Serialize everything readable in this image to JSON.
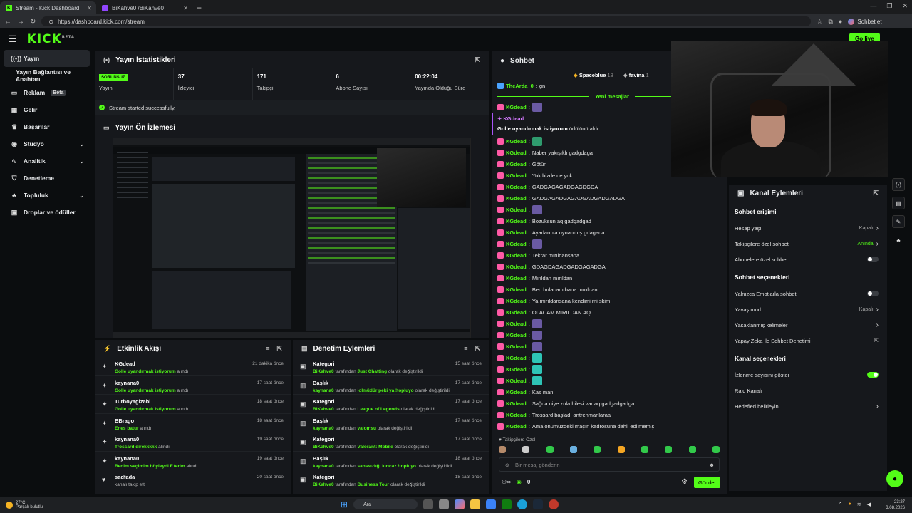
{
  "browser": {
    "tabs": [
      {
        "label": "Stream - Kick Dashboard",
        "active": true
      },
      {
        "label": "BiKahve0 /BiKahve0",
        "active": false
      }
    ],
    "url": "https://dashboard.kick.com/stream",
    "chat_button": "Sohbet et"
  },
  "header": {
    "logo": "KICK",
    "logo_beta": "BETA",
    "go_live": "Go live"
  },
  "sidebar": {
    "items": [
      {
        "label": "Yayın",
        "icon": "broadcast-icon",
        "active": true
      },
      {
        "label": "Yayın Bağlantısı ve Anahtarı",
        "sub": true
      },
      {
        "label": "Reklam",
        "icon": "ad-icon",
        "badge": "Beta"
      },
      {
        "label": "Gelir",
        "icon": "money-icon"
      },
      {
        "label": "Başarılar",
        "icon": "trophy-icon"
      },
      {
        "label": "Stüdyo",
        "icon": "studio-icon",
        "chevron": true
      },
      {
        "label": "Analitik",
        "icon": "chart-icon",
        "chevron": true
      },
      {
        "label": "Denetleme",
        "icon": "shield-icon"
      },
      {
        "label": "Topluluk",
        "icon": "community-icon",
        "chevron": true
      },
      {
        "label": "Droplar ve ödüller",
        "icon": "gift-icon"
      }
    ]
  },
  "stats": {
    "title": "Yayın İstatistikleri",
    "items": [
      {
        "value": "SORUNSUZ",
        "label": "Yayın"
      },
      {
        "value": "37",
        "label": "İzleyici"
      },
      {
        "value": "171",
        "label": "Takipçi"
      },
      {
        "value": "6",
        "label": "Abone Sayısı"
      },
      {
        "value": "00:22:04",
        "label": "Yayında Olduğu Süre"
      }
    ],
    "status": "Stream started successfully."
  },
  "preview": {
    "title": "Yayın Ön İzlemesi"
  },
  "activity": {
    "title": "Etkinlik Akışı",
    "rows": [
      {
        "name": "KGdead",
        "reward": "Golle uyandırmak istiyorum",
        "suffix": "alındı",
        "time": "21 dakika önce"
      },
      {
        "name": "kaynana0",
        "reward": "Golle uyandırmak istiyorum",
        "suffix": "alındı",
        "time": "17 saat önce"
      },
      {
        "name": "Turboyagizabi",
        "reward": "Golle uyandırmak istiyorum",
        "suffix": "alındı",
        "time": "18 saat önce"
      },
      {
        "name": "BBrago",
        "reward": "Enes batur",
        "suffix": "alındı",
        "time": "18 saat önce"
      },
      {
        "name": "kaynana0",
        "reward": "Trossard direkkkkk",
        "suffix": "alındı",
        "time": "19 saat önce"
      },
      {
        "name": "kaynana0",
        "reward": "Benim seçimim böyleydi F.terim",
        "suffix": "alındı",
        "time": "19 saat önce"
      },
      {
        "name": "sadfada",
        "reward": "",
        "suffix": "kanalı takip etti",
        "time": "20 saat önce"
      }
    ]
  },
  "moderation": {
    "title": "Denetim Eylemleri",
    "rows": [
      {
        "type": "Kategori",
        "by": "BiKahve0",
        "mid": "tarafından",
        "value": "Just Chatting",
        "suffix": "olarak değiştirildi",
        "time": "15 saat önce"
      },
      {
        "type": "Başlık",
        "by": "kaynana0",
        "mid": "tarafından",
        "value": "lolmüdür peki ya !topluyo",
        "suffix": "olarak değiştirildi",
        "time": "17 saat önce"
      },
      {
        "type": "Kategori",
        "by": "BiKahve0",
        "mid": "tarafından",
        "value": "League of Legends",
        "suffix": "olarak değiştirildi",
        "time": "17 saat önce"
      },
      {
        "type": "Başlık",
        "by": "kaynana0",
        "mid": "tarafından",
        "value": "valomsu",
        "suffix": "olarak değiştirildi",
        "time": "17 saat önce"
      },
      {
        "type": "Kategori",
        "by": "BiKahve0",
        "mid": "tarafından",
        "value": "Valorant: Mobile",
        "suffix": "olarak değiştirildi",
        "time": "17 saat önce"
      },
      {
        "type": "Başlık",
        "by": "kaynana0",
        "mid": "tarafından",
        "value": "sanssızlığı kırıcaz !topluyo",
        "suffix": "olarak değiştirildi",
        "time": "18 saat önce"
      },
      {
        "type": "Kategori",
        "by": "BiKahve0",
        "mid": "tarafından",
        "value": "Business Tour",
        "suffix": "olarak değiştirildi",
        "time": "18 saat önce"
      }
    ]
  },
  "chat": {
    "title": "Sohbet",
    "leaders": [
      {
        "name": "Spaceblue",
        "count": "13"
      },
      {
        "name": "favina",
        "count": "1"
      }
    ],
    "top_msg": {
      "user": "TheArda_0",
      "text": "gn"
    },
    "new_messages": "Yeni mesajlar",
    "redeem": {
      "user": "KGdead",
      "text": "Golle uyandırmak istiyorum",
      "suffix": "ödülünü aldı"
    },
    "messages": [
      {
        "user": "KGdead",
        "text": "",
        "emote": "p"
      },
      {
        "user": "KGdead",
        "text": "",
        "emote": "g"
      },
      {
        "user": "KGdead",
        "text": "Naber yakışıklı gadgdaga"
      },
      {
        "user": "KGdead",
        "text": "Götün"
      },
      {
        "user": "KGdead",
        "text": "Yok bizde de yok"
      },
      {
        "user": "KGdead",
        "text": "GADGAGAGADGAGDGDA"
      },
      {
        "user": "KGdead",
        "text": "GADGAGADGAGADGADGADGADGA"
      },
      {
        "user": "KGdead",
        "text": "",
        "emote": "p"
      },
      {
        "user": "KGdead",
        "text": "Bozuksun aq gadgadgad"
      },
      {
        "user": "KGdead",
        "text": "Ayarlarınla oynanmış gdagada"
      },
      {
        "user": "KGdead",
        "text": "",
        "emote": "p"
      },
      {
        "user": "KGdead",
        "text": "Tekrar mırıldansana"
      },
      {
        "user": "KGdead",
        "text": "GDAGDAGADGADGAGADGA"
      },
      {
        "user": "KGdead",
        "text": "Mırıldan mırıldan"
      },
      {
        "user": "KGdead",
        "text": "Ben bulacam bana mırıldan"
      },
      {
        "user": "KGdead",
        "text": "Ya mırıldansana kendimi mi skim"
      },
      {
        "user": "KGdead",
        "text": "OLACAM MIRILDAN AQ"
      },
      {
        "user": "KGdead",
        "text": "",
        "emote": "p"
      },
      {
        "user": "KGdead",
        "text": "",
        "emote": "p"
      },
      {
        "user": "KGdead",
        "text": "",
        "emote": "p"
      },
      {
        "user": "KGdead",
        "text": "",
        "emote": "c"
      },
      {
        "user": "KGdead",
        "text": "",
        "emote": "c"
      },
      {
        "user": "KGdead",
        "text": "",
        "emote": "c"
      },
      {
        "user": "KGdead",
        "text": "Kas man"
      },
      {
        "user": "KGdead",
        "text": "Sağda niye zula hilesi var aq gadgadgadga"
      },
      {
        "user": "KGdead",
        "text": "Trossard başladı antrenmanlaraa"
      },
      {
        "user": "KGdead",
        "text": "Ama önümüzdeki maçın kadrosuna dahil edilmemiş"
      }
    ],
    "followers_only": "Takipçilere Özel",
    "input_placeholder": "Bir mesaj gönderin",
    "points": "0",
    "send": "Gönder"
  },
  "channel_actions": {
    "title": "Kanal Eylemleri",
    "sections": [
      {
        "heading": "Sohbet erişimi",
        "rows": [
          {
            "label": "Hesap yaşı",
            "value": "Kapalı",
            "kind": "chevron"
          },
          {
            "label": "Takipçilere özel sohbet",
            "value": "Anında",
            "kind": "chevron",
            "green": true
          },
          {
            "label": "Abonelere özel sohbet",
            "kind": "toggle",
            "on": false
          }
        ]
      },
      {
        "heading": "Sohbet seçenekleri",
        "rows": [
          {
            "label": "Yalnızca Emotlarla sohbet",
            "kind": "toggle",
            "on": false
          },
          {
            "label": "Yavaş mod",
            "value": "Kapalı",
            "kind": "chevron"
          },
          {
            "label": "Yasaklanmış kelimeler",
            "kind": "chevron"
          },
          {
            "label": "Yapay Zeka ile Sohbet Denetimi",
            "kind": "ext"
          }
        ]
      },
      {
        "heading": "Kanal seçenekleri",
        "rows": [
          {
            "label": "İzlenme sayısını göster",
            "kind": "toggle",
            "on": true
          },
          {
            "label": "Raid Kanalı",
            "kind": "none"
          },
          {
            "label": "Hedefleri belirleyin",
            "kind": "chevron"
          }
        ]
      }
    ]
  },
  "taskbar": {
    "weather_temp": "27°C",
    "weather_desc": "Parçalı bulutlu",
    "search": "Ara",
    "time": "23:27",
    "date": "3.08.2026"
  },
  "colors": {
    "accent": "#53fc18",
    "panel": "#16181c",
    "bg": "#0b0d0f",
    "redeem": "#a855f7"
  }
}
